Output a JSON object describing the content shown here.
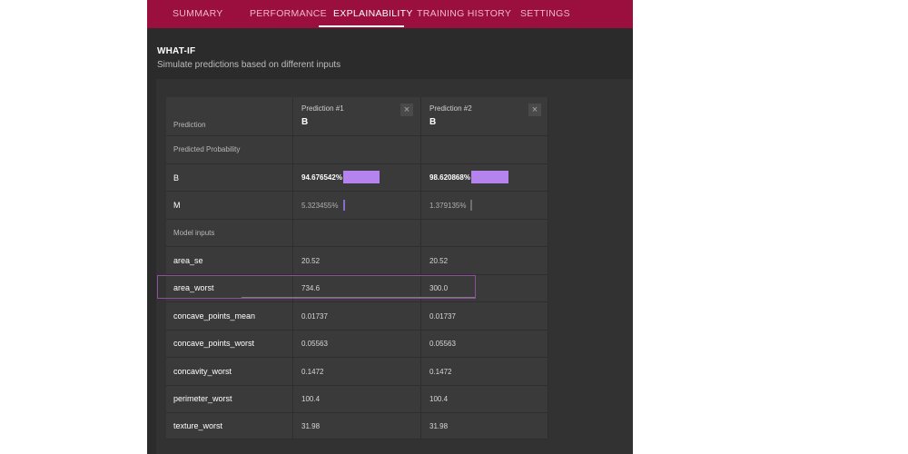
{
  "tabs": [
    {
      "label": "SUMMARY",
      "active": false
    },
    {
      "label": "PERFORMANCE",
      "active": false
    },
    {
      "label": "EXPLAINABILITY",
      "active": true
    },
    {
      "label": "TRAINING HISTORY",
      "active": false
    },
    {
      "label": "SETTINGS",
      "active": false
    }
  ],
  "whatif": {
    "title": "WHAT-IF",
    "subtitle": "Simulate predictions based on different inputs"
  },
  "table": {
    "prediction_label": "Prediction",
    "predicted_probability_label": "Predicted Probability",
    "model_inputs_label": "Model inputs",
    "predictions": [
      {
        "header": "Prediction #1",
        "value": "B",
        "prob_B": "94.676542%",
        "prob_M": "5.323455%",
        "prob_B_fraction": 0.9468,
        "prob_M_fraction": 0.0532
      },
      {
        "header": "Prediction #2",
        "value": "B",
        "prob_B": "98.620868%",
        "prob_M": "1.379135%",
        "prob_B_fraction": 0.9862,
        "prob_M_fraction": 0.0138
      }
    ],
    "classes": [
      "B",
      "M"
    ],
    "inputs": [
      {
        "name": "area_se",
        "values": [
          "20.52",
          "20.52"
        ]
      },
      {
        "name": "area_worst",
        "values": [
          "734.6",
          "300.0"
        ]
      },
      {
        "name": "concave_points_mean",
        "values": [
          "0.01737",
          "0.01737"
        ]
      },
      {
        "name": "concave_points_worst",
        "values": [
          "0.05563",
          "0.05563"
        ]
      },
      {
        "name": "concavity_worst",
        "values": [
          "0.1472",
          "0.1472"
        ]
      },
      {
        "name": "perimeter_worst",
        "values": [
          "100.4",
          "100.4"
        ]
      },
      {
        "name": "texture_worst",
        "values": [
          "31.98",
          "31.98"
        ]
      }
    ]
  },
  "colors": {
    "nav_background": "#9a0f3e",
    "probability_bar": "#b583ee"
  },
  "icons": {
    "close": "close-icon"
  }
}
